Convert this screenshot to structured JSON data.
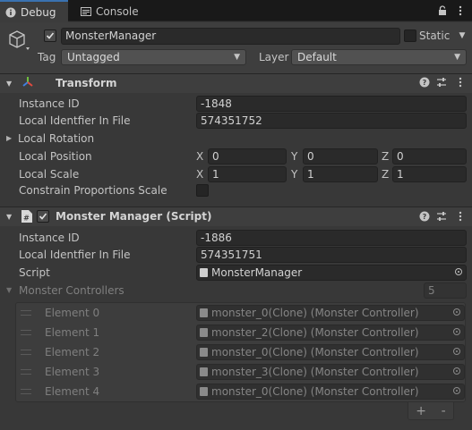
{
  "tabs": [
    {
      "label": "Debug",
      "icon": "info-icon",
      "active": true
    },
    {
      "label": "Console",
      "icon": "console-icon",
      "active": false
    }
  ],
  "gameobject": {
    "name": "MonsterManager",
    "static_label": "Static",
    "tag_label": "Tag",
    "tag_value": "Untagged",
    "layer_label": "Layer",
    "layer_value": "Default"
  },
  "transform": {
    "title": "Transform",
    "instance_id_label": "Instance ID",
    "instance_id": "-1848",
    "local_id_label": "Local Identfier In File",
    "local_id": "574351752",
    "local_rotation_label": "Local Rotation",
    "local_position_label": "Local Position",
    "local_position": {
      "x": "0",
      "y": "0",
      "z": "0"
    },
    "local_scale_label": "Local Scale",
    "local_scale": {
      "x": "1",
      "y": "1",
      "z": "1"
    },
    "constrain_label": "Constrain Proportions Scale",
    "axis_x": "X",
    "axis_y": "Y",
    "axis_z": "Z"
  },
  "script_component": {
    "title": "Monster Manager (Script)",
    "instance_id_label": "Instance ID",
    "instance_id": "-1886",
    "local_id_label": "Local Identfier In File",
    "local_id": "574351751",
    "script_label": "Script",
    "script_value": "MonsterManager",
    "list_label": "Monster Controllers",
    "list_count": "5",
    "elements": [
      {
        "label": "Element 0",
        "value": "monster_0(Clone) (Monster Controller)"
      },
      {
        "label": "Element 1",
        "value": "monster_2(Clone) (Monster Controller)"
      },
      {
        "label": "Element 2",
        "value": "monster_0(Clone) (Monster Controller)"
      },
      {
        "label": "Element 3",
        "value": "monster_3(Clone) (Monster Controller)"
      },
      {
        "label": "Element 4",
        "value": "monster_0(Clone) (Monster Controller)"
      }
    ],
    "add_label": "+",
    "remove_label": "-"
  },
  "colors": {
    "background": "#383838",
    "tab_active_accent": "#3a72b0",
    "field": "#2a2a2a"
  }
}
